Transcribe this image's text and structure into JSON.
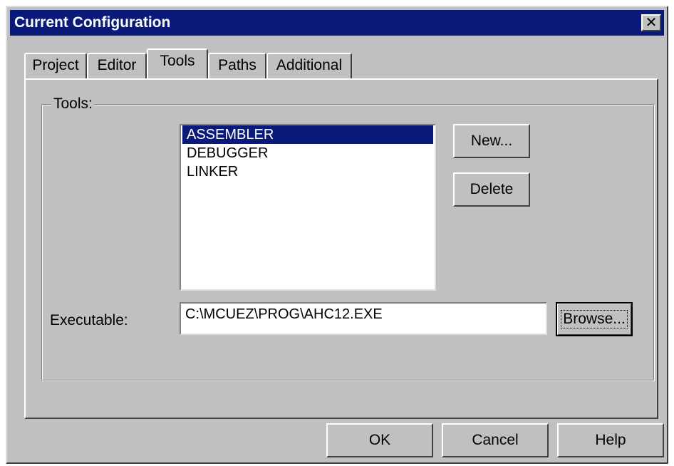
{
  "window": {
    "title": "Current Configuration",
    "close_glyph": "✕"
  },
  "tabs": [
    {
      "label": "Project"
    },
    {
      "label": "Editor"
    },
    {
      "label": "Tools",
      "active": true
    },
    {
      "label": "Paths"
    },
    {
      "label": "Additional"
    }
  ],
  "tools_group": {
    "label": "Tools:",
    "items": [
      "ASSEMBLER",
      "DEBUGGER",
      "LINKER"
    ],
    "selected": "ASSEMBLER",
    "new_label": "New...",
    "delete_label": "Delete"
  },
  "executable": {
    "label": "Executable:",
    "value": "C:\\MCUEZ\\PROG\\AHC12.EXE",
    "browse_label": "Browse..."
  },
  "footer": {
    "ok_label": "OK",
    "cancel_label": "Cancel",
    "help_label": "Help"
  },
  "colors": {
    "title_bar": "#0a1a7a",
    "selection": "#0a1a7a",
    "face": "#c0c0c0"
  },
  "icons": {
    "close": "close-icon"
  }
}
